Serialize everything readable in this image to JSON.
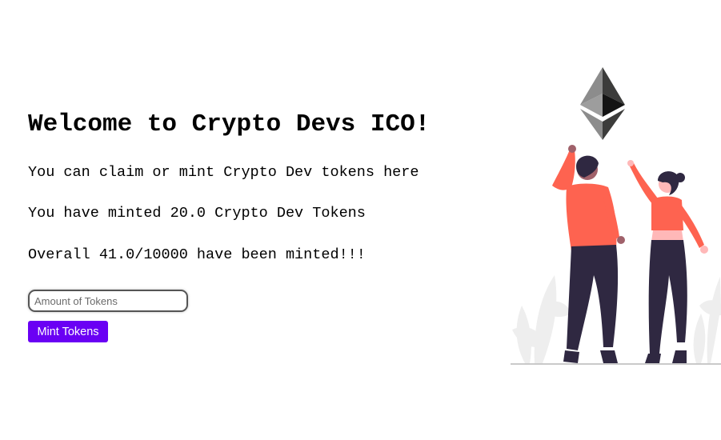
{
  "hero": {
    "title": "Welcome to Crypto Devs ICO!",
    "description": "You can claim or mint Crypto Dev tokens here",
    "minted_line": "You have minted 20.0 Crypto Dev Tokens",
    "overall_line": "Overall 41.0/10000 have been minted!!!"
  },
  "mint_form": {
    "amount_placeholder": "Amount of Tokens",
    "amount_value": "",
    "button_label": "Mint Tokens"
  },
  "colors": {
    "button_bg": "#6a00f4",
    "shirt": "#fe6350",
    "pants": "#2f2841",
    "eth_dark": "#343434",
    "eth_mid": "#8c8c8c"
  },
  "icons": {
    "illustration": "people-reaching-ethereum-illustration",
    "logo": "ethereum-icon"
  }
}
